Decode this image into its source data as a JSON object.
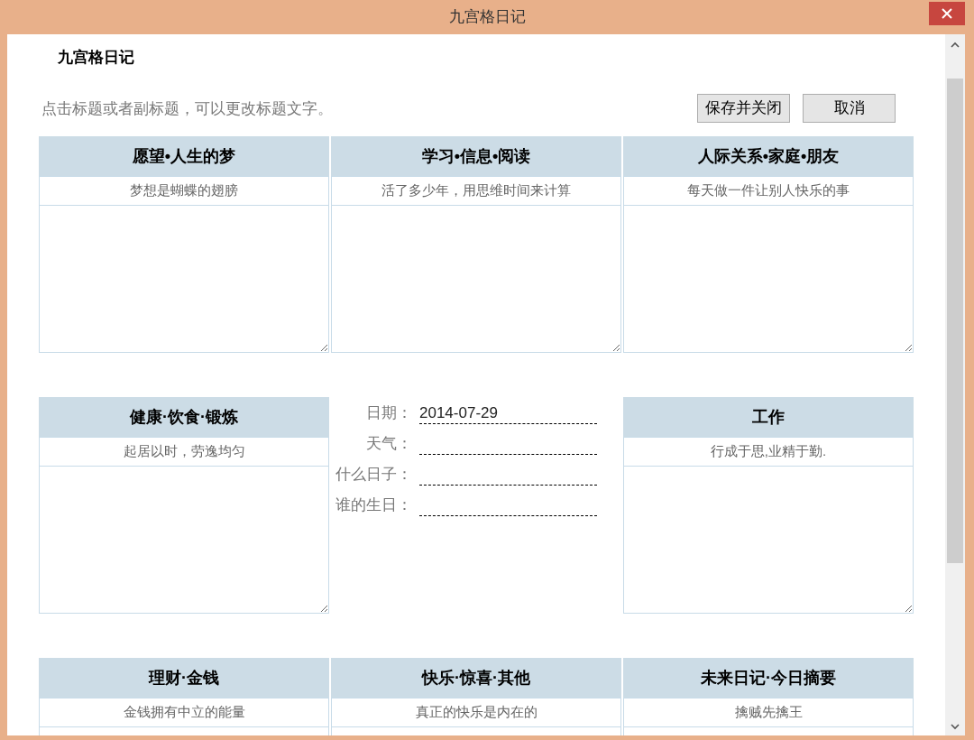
{
  "window": {
    "title": "九宫格日记"
  },
  "heading": "九宫格日记",
  "hint": "点击标题或者副标题，可以更改标题文字。",
  "buttons": [
    {
      "label": "保存并关闭"
    },
    {
      "label": "取消"
    }
  ],
  "grid": [
    {
      "kind": "topic",
      "title": "愿望•人生的梦",
      "subtitle": "梦想是蝴蝶的翅膀"
    },
    {
      "kind": "topic",
      "title": "学习•信息•阅读",
      "subtitle": "活了多少年，用思维时间来计算"
    },
    {
      "kind": "topic",
      "title": "人际关系•家庭•朋友",
      "subtitle": "每天做一件让别人快乐的事"
    },
    {
      "kind": "topic",
      "title": "健康·饮食·锻炼",
      "subtitle": "起居以时，劳逸均匀"
    },
    {
      "kind": "info",
      "fields": [
        {
          "label": "日期：",
          "value": "2014-07-29"
        },
        {
          "label": "天气："
        },
        {
          "label": "什么日子："
        },
        {
          "label": "谁的生日："
        }
      ]
    },
    {
      "kind": "topic",
      "title": "工作",
      "subtitle": "行成于思,业精于勤."
    },
    {
      "kind": "topic",
      "title": "理财·金钱",
      "subtitle": "金钱拥有中立的能量"
    },
    {
      "kind": "topic",
      "title": "快乐·惊喜·其他",
      "subtitle": "真正的快乐是内在的"
    },
    {
      "kind": "topic",
      "title": "未来日记·今日摘要",
      "subtitle": "擒贼先擒王"
    }
  ]
}
